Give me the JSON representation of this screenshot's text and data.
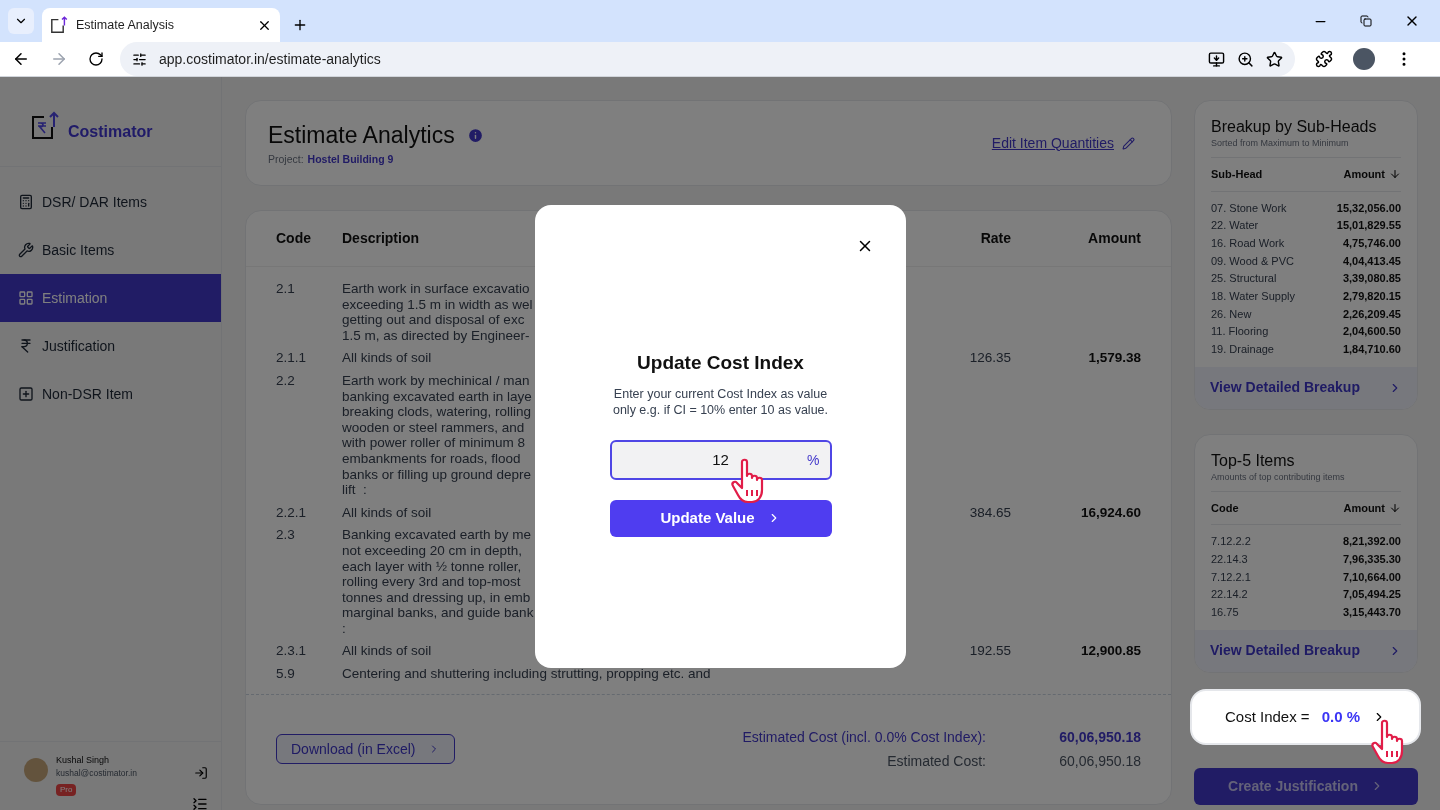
{
  "browser": {
    "tab_title": "Estimate Analysis",
    "url": "app.costimator.in/estimate-analytics"
  },
  "sidebar": {
    "brand": "Costimator",
    "items": [
      {
        "label": "DSR/ DAR Items",
        "selected": false
      },
      {
        "label": "Basic Items",
        "selected": false
      },
      {
        "label": "Estimation",
        "selected": true
      },
      {
        "label": "Justification",
        "selected": false
      },
      {
        "label": "Non-DSR Item",
        "selected": false
      }
    ],
    "user": {
      "name": "Kushal Singh",
      "email": "kushal@costimator.in",
      "badge": "Pro"
    }
  },
  "header": {
    "title": "Estimate Analytics",
    "project_label": "Project:",
    "project_name": "Hostel Building 9",
    "edit_link": "Edit Item Quantities"
  },
  "table": {
    "columns": [
      "Code",
      "Description",
      "Rate",
      "Amount"
    ],
    "rows": [
      {
        "code": "2.1",
        "description": [
          "Earth work in surface excavatio",
          "exceeding 1.5 m in width as wel",
          "getting out and disposal of exc",
          "1.5 m, as directed by Engineer-"
        ]
      },
      {
        "code": "2.1.1",
        "description": [
          "All kinds of soil"
        ],
        "rate": "126.35",
        "amount": "1,579.38"
      },
      {
        "code": "2.2",
        "description": [
          "Earth work by mechinical / man",
          "banking excavated earth in laye",
          "breaking clods, watering, rolling",
          "wooden or steel rammers, and",
          "with power roller of minimum 8",
          "embankments for roads, flood",
          "banks or filling up ground depre",
          "lift  :"
        ]
      },
      {
        "code": "2.2.1",
        "description": [
          "All kinds of soil"
        ],
        "rate": "384.65",
        "amount": "16,924.60"
      },
      {
        "code": "2.3",
        "description": [
          "Banking excavated earth by me",
          "not exceeding 20 cm in depth,",
          "each layer with ½ tonne roller,",
          "rolling every 3rd and top-most",
          "tonnes and dressing up, in emb",
          "marginal banks, and guide bank",
          ":"
        ]
      },
      {
        "code": "2.3.1",
        "description": [
          "All kinds of soil"
        ],
        "rate": "192.55",
        "amount": "12,900.85"
      },
      {
        "code": "5.9",
        "description": [
          "Centering and shuttering including strutting, propping etc. and"
        ]
      }
    ]
  },
  "footer": {
    "download_button": "Download (in Excel)",
    "totals": [
      {
        "label": "Estimated Cost (incl. 0.0% Cost Index):",
        "value": "60,06,950.18",
        "kind": "indexed"
      },
      {
        "label": "Estimated Cost:",
        "value": "60,06,950.18",
        "kind": "plain"
      }
    ]
  },
  "breakup": {
    "title": "Breakup by Sub-Heads",
    "subtitle": "Sorted from Maximum to Minimum",
    "columns": [
      "Sub-Head",
      "Amount"
    ],
    "rows": [
      {
        "name": "07. Stone Work",
        "amount": "15,32,056.00"
      },
      {
        "name": "22. Water",
        "amount": "15,01,829.55"
      },
      {
        "name": "16. Road Work",
        "amount": "4,75,746.00"
      },
      {
        "name": "09. Wood & PVC",
        "amount": "4,04,413.45"
      },
      {
        "name": "25. Structural",
        "amount": "3,39,080.85"
      },
      {
        "name": "18. Water Supply",
        "amount": "2,79,820.15"
      },
      {
        "name": "26. New",
        "amount": "2,26,209.45"
      },
      {
        "name": "11. Flooring",
        "amount": "2,04,600.50"
      },
      {
        "name": "19. Drainage",
        "amount": "1,84,710.60"
      }
    ],
    "link": "View Detailed Breakup"
  },
  "top_items": {
    "title": "Top-5 Items",
    "subtitle": "Amounts of top contributing items",
    "columns": [
      "Code",
      "Amount"
    ],
    "rows": [
      {
        "name": "7.12.2.2",
        "amount": "8,21,392.00"
      },
      {
        "name": "22.14.3",
        "amount": "7,96,335.30"
      },
      {
        "name": "7.12.2.1",
        "amount": "7,10,664.00"
      },
      {
        "name": "22.14.2",
        "amount": "7,05,494.25"
      },
      {
        "name": "16.75",
        "amount": "3,15,443.70"
      }
    ],
    "link": "View Detailed Breakup"
  },
  "cost_index": {
    "label": "Cost Index =",
    "value": "0.0 %"
  },
  "create_button": "Create Justification",
  "modal": {
    "title": "Update Cost Index",
    "text": "Enter your current Cost Index as value only e.g. if CI = 10% enter 10 as value.",
    "input_value": "12",
    "suffix": "%",
    "button": "Update Value"
  }
}
